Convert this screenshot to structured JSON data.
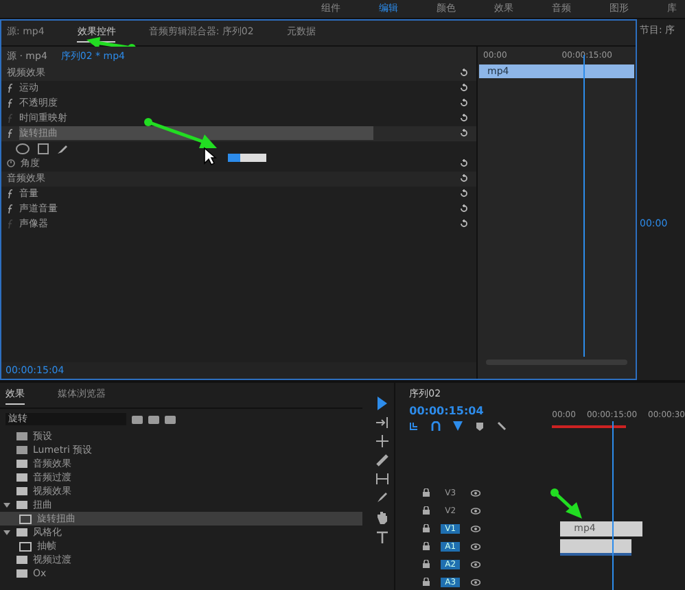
{
  "menu": [
    {
      "label": "组件",
      "selected": false
    },
    {
      "label": "编辑",
      "selected": true
    },
    {
      "label": "颜色",
      "selected": false
    },
    {
      "label": "效果",
      "selected": false
    },
    {
      "label": "音频",
      "selected": false
    },
    {
      "label": "图形",
      "selected": false
    },
    {
      "label": "库",
      "selected": false
    }
  ],
  "effect_controls": {
    "tabs": [
      {
        "label": "源: mp4",
        "selected": false
      },
      {
        "label": "效果控件",
        "selected": true
      },
      {
        "label": "音频剪辑混合器: 序列02",
        "selected": false
      },
      {
        "label": "元数据",
        "selected": false
      }
    ],
    "source_label": "源 · mp4",
    "sequence_label": "序列02 * mp4",
    "rows": [
      {
        "kind": "section",
        "label": "视频效果"
      },
      {
        "kind": "effect",
        "label": "运动",
        "fx": true,
        "selected": false
      },
      {
        "kind": "effect",
        "label": "不透明度",
        "fx": true,
        "selected": false
      },
      {
        "kind": "effect",
        "label": "时间重映射",
        "fx": false,
        "selected": false
      },
      {
        "kind": "effect",
        "label": "旋转扭曲",
        "fx": true,
        "selected": true
      },
      {
        "kind": "masks"
      },
      {
        "kind": "param",
        "label": "角度"
      },
      {
        "kind": "section",
        "label": "音频效果"
      },
      {
        "kind": "effect",
        "label": "音量",
        "fx": true,
        "selected": false
      },
      {
        "kind": "effect",
        "label": "声道音量",
        "fx": true,
        "selected": false
      },
      {
        "kind": "effect",
        "label": "声像器",
        "fx": false,
        "selected": false
      }
    ],
    "ruler": [
      "00:00",
      "00:00:15:00"
    ],
    "clip": "mp4",
    "timecode": "00:00:15:04"
  },
  "program": {
    "title": "节目: 序",
    "timecode": "00:00"
  },
  "effects_panel": {
    "tabs": [
      {
        "label": "效果",
        "selected": true
      },
      {
        "label": "媒体浏览器",
        "selected": false
      }
    ],
    "search": "旋转",
    "tree": [
      {
        "kind": "preset",
        "label": "预设"
      },
      {
        "kind": "preset",
        "label": "Lumetri 预设"
      },
      {
        "kind": "folder",
        "label": "音频效果"
      },
      {
        "kind": "folder",
        "label": "音频过渡"
      },
      {
        "kind": "folder",
        "label": "视频效果"
      },
      {
        "kind": "folder",
        "label": "扭曲",
        "expanded": true,
        "children": [
          {
            "label": "旋转扭曲",
            "selected": true
          }
        ]
      },
      {
        "kind": "folder",
        "label": "风格化",
        "expanded": true,
        "children": [
          {
            "label": "抽帧",
            "selected": false
          }
        ]
      },
      {
        "kind": "folder",
        "label": "视频过渡"
      },
      {
        "kind": "folder",
        "label": "Ox"
      }
    ]
  },
  "timeline": {
    "title": "序列02",
    "timecode": "00:00:15:04",
    "ruler": [
      "00:00",
      "00:00:15:00",
      "00:00:30"
    ],
    "tracks": [
      {
        "name": "V3",
        "targeted": false
      },
      {
        "name": "V2",
        "targeted": false
      },
      {
        "name": "V1",
        "targeted": true
      },
      {
        "name": "A1",
        "targeted": true
      },
      {
        "name": "A2",
        "targeted": true
      },
      {
        "name": "A3",
        "targeted": true
      }
    ],
    "video_clip": "mp4"
  }
}
